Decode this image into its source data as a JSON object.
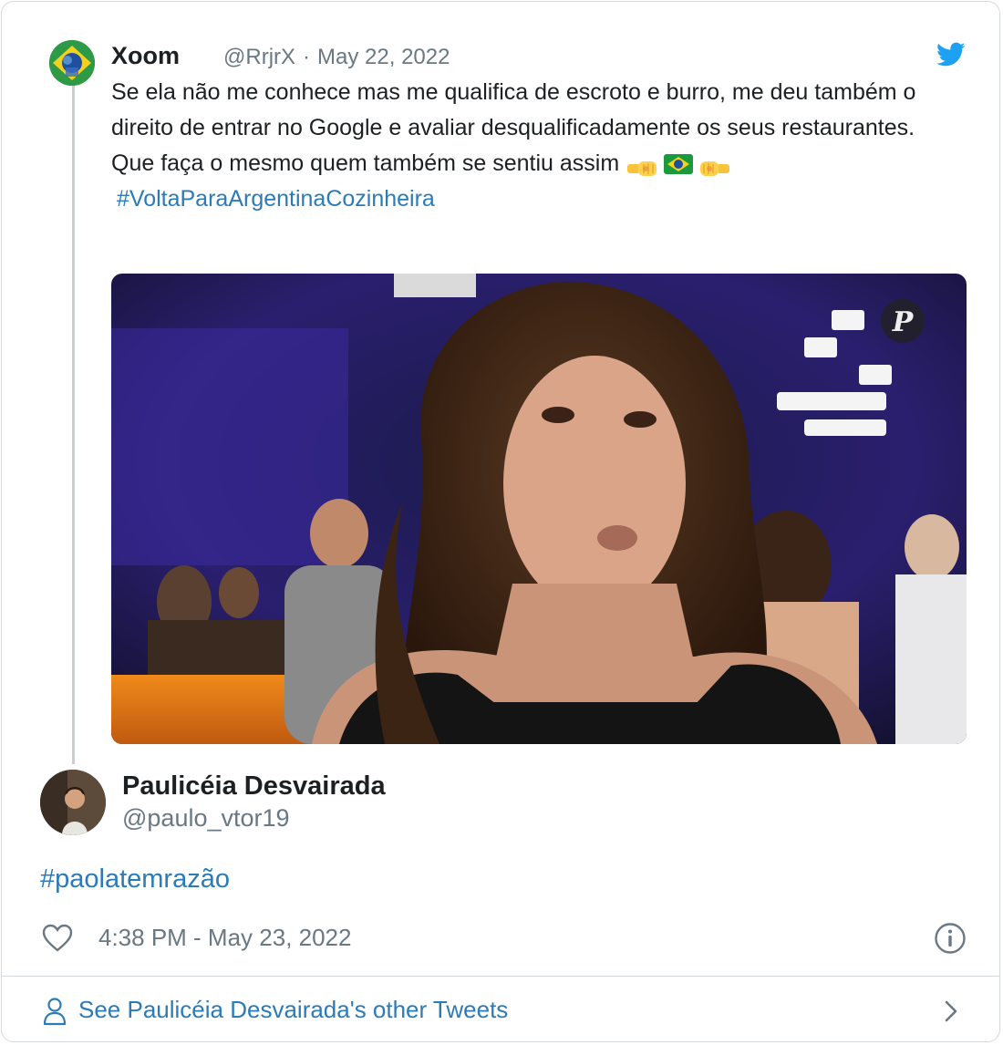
{
  "quoted_tweet": {
    "display_name": "Xoom",
    "handle": "@RrjrX",
    "separator": "·",
    "date": "May 22, 2022",
    "text_line_1": "Se ela não me conhece mas me qualifica de escroto e burro, me deu também o direito de entrar no Google e avaliar desqualificadamente os seus restaurantes.",
    "text_line_2": "Que faça o mesmo quem também se sentiu assim",
    "hashtag": "#VoltaParaArgentinaCozinheira",
    "watermark": "P"
  },
  "tweet": {
    "display_name": "Paulicéia Desvairada",
    "handle": "@paulo_vtor19",
    "text": "#paolatemrazão",
    "timestamp": "4:38 PM - May 23, 2022"
  },
  "footer": {
    "link_text": "See Paulicéia Desvairada's other Tweets"
  },
  "icons": {
    "brand": "twitter-bird-icon",
    "like": "heart-icon",
    "info": "info-icon",
    "profile": "person-icon",
    "navigate": "chevron-right-icon"
  },
  "colors": {
    "link": "#2b7bb9",
    "muted": "#697882",
    "text": "#1c2022",
    "border": "#d3d9dd",
    "twitter_blue": "#1da1f2"
  }
}
